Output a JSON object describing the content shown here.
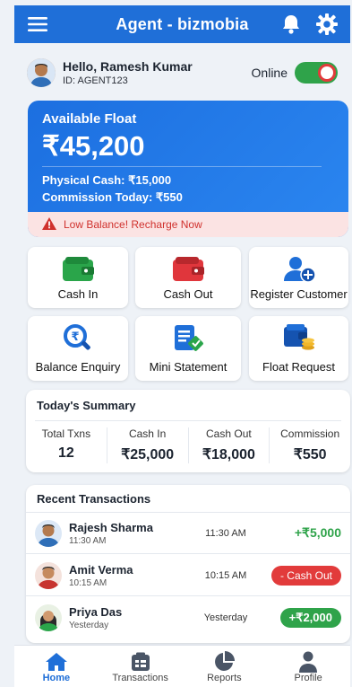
{
  "appbar": {
    "title": "Agent - bizmobia"
  },
  "user": {
    "greeting": "Hello, Ramesh Kumar",
    "agent_id": "ID: AGENT123",
    "status_label": "Online",
    "online": true
  },
  "float": {
    "label": "Available Float",
    "amount": "₹45,200",
    "physical_cash": "Physical Cash: ₹15,000",
    "commission_today": "Commission Today: ₹550",
    "alert": "Low Balance! Recharge Now"
  },
  "actions": [
    {
      "label": "Cash In",
      "icon": "wallet-green-icon"
    },
    {
      "label": "Cash Out",
      "icon": "wallet-red-icon"
    },
    {
      "label": "Register Customer",
      "icon": "add-user-icon"
    },
    {
      "label": "Balance Enquiry",
      "icon": "search-rupee-icon"
    },
    {
      "label": "Mini Statement",
      "icon": "statement-icon"
    },
    {
      "label": "Float Request",
      "icon": "wallet-coins-icon"
    }
  ],
  "summary": {
    "title": "Today's Summary",
    "items": [
      {
        "label": "Total Txns",
        "value": "12"
      },
      {
        "label": "Cash In",
        "value": "₹25,000"
      },
      {
        "label": "Cash Out",
        "value": "₹18,000"
      },
      {
        "label": "Commission",
        "value": "₹550"
      }
    ]
  },
  "recent": {
    "title": "Recent Transactions",
    "rows": [
      {
        "name": "Rajesh Sharma",
        "sub": "11:30 AM",
        "time": "11:30 AM",
        "amount": "+₹5,000",
        "style": "text-green"
      },
      {
        "name": "Amit Verma",
        "sub": "10:15 AM",
        "time": "10:15 AM",
        "amount": "- Cash Out",
        "style": "pill-red"
      },
      {
        "name": "Priya Das",
        "sub": "Yesterday",
        "time": "Yesterday",
        "amount": "+₹2,000",
        "style": "pill-green"
      }
    ]
  },
  "nav": [
    {
      "label": "Home",
      "icon": "home-icon",
      "active": true
    },
    {
      "label": "Transactions",
      "icon": "transactions-icon",
      "active": false
    },
    {
      "label": "Reports",
      "icon": "pie-chart-icon",
      "active": false
    },
    {
      "label": "Profile",
      "icon": "person-icon",
      "active": false
    }
  ],
  "colors": {
    "primary": "#1f6fd8",
    "green": "#2fa34a",
    "red": "#e23b3b"
  }
}
